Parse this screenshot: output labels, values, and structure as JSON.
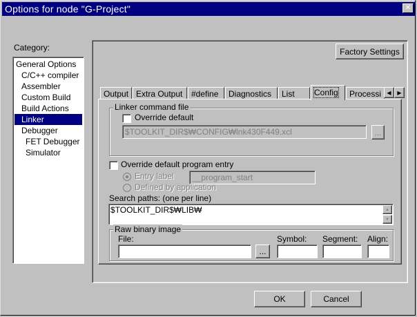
{
  "window": {
    "title": "Options for node \"G-Project\"",
    "close_glyph": "✕"
  },
  "category": {
    "label": "Category:",
    "items": [
      {
        "label": "General Options",
        "indent": 0
      },
      {
        "label": "C/C++ compiler",
        "indent": 1
      },
      {
        "label": "Assembler",
        "indent": 1
      },
      {
        "label": "Custom Build",
        "indent": 1
      },
      {
        "label": "Build Actions",
        "indent": 1
      },
      {
        "label": "Linker",
        "indent": 1,
        "selected": true
      },
      {
        "label": "Debugger",
        "indent": 1
      },
      {
        "label": "FET Debugger",
        "indent": 2
      },
      {
        "label": "Simulator",
        "indent": 2
      }
    ]
  },
  "factory_settings_label": "Factory Settings",
  "tabs": [
    {
      "label": "Output"
    },
    {
      "label": "Extra Output"
    },
    {
      "label": "#define"
    },
    {
      "label": "Diagnostics"
    },
    {
      "label": "List"
    },
    {
      "label": "Config",
      "active": true
    },
    {
      "label": "Processi"
    }
  ],
  "tab_scroll": {
    "left": "◀",
    "right": "▶"
  },
  "linker_cmd": {
    "group_label": "Linker command file",
    "override_label": "Override default",
    "override_checked": false,
    "path_value": "$TOOLKIT_DIR$₩CONFIG₩lnk430F449.xcl",
    "browse_label": "..."
  },
  "program_entry": {
    "override_label": "Override default program entry",
    "override_checked": false,
    "entry_label_option": "Entry label",
    "entry_label_value": "__program_start",
    "defined_by_app_option": "Defined by application"
  },
  "search_paths": {
    "label": "Search paths:  (one per line)",
    "value": "$TOOLKIT_DIR$₩LIB₩"
  },
  "raw_binary": {
    "group_label": "Raw binary image",
    "file_label": "File:",
    "file_value": "",
    "browse_label": "...",
    "symbol_label": "Symbol:",
    "symbol_value": "",
    "segment_label": "Segment:",
    "segment_value": "",
    "align_label": "Align:",
    "align_value": ""
  },
  "buttons": {
    "ok": "OK",
    "cancel": "Cancel"
  }
}
